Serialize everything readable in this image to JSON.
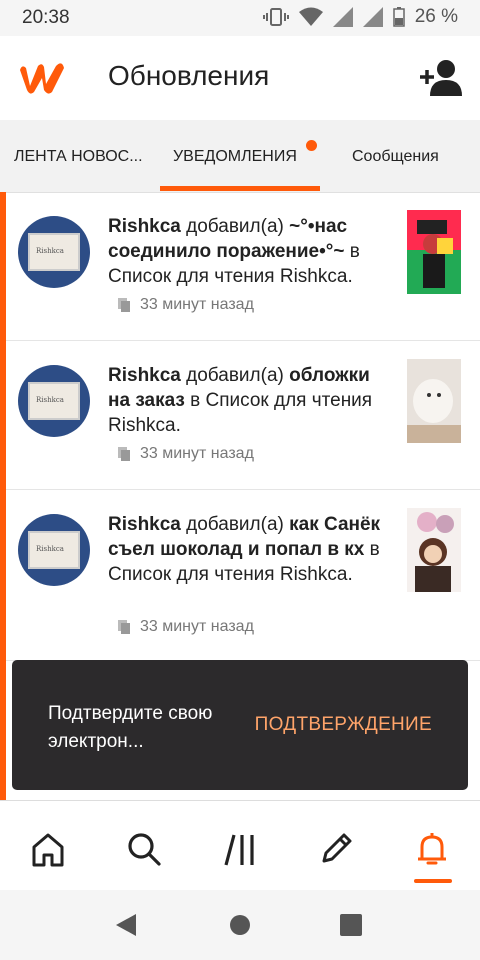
{
  "status": {
    "time": "20:38",
    "battery": "26 %"
  },
  "header": {
    "title": "Обновления"
  },
  "tabs": [
    {
      "label": "ЛЕНТА НОВОС..."
    },
    {
      "label": "УВЕДОМЛЕНИЯ"
    },
    {
      "label": "Сообщения"
    }
  ],
  "notifications": [
    {
      "user": "Rishkca",
      "action": "добавил(а)",
      "story": "~°•нас соединило поражение•°~",
      "prep": "в",
      "list": "Список для чтения Rishkca",
      "time": "33 минут назад"
    },
    {
      "user": "Rishkca",
      "action": "добавил(а)",
      "story": "обложки на заказ",
      "prep": "в",
      "list": "Список для чтения Rishkca",
      "time": "33 минут назад"
    },
    {
      "user": "Rishkca",
      "action": "добавил(а)",
      "story": "как Санёк съел шоколад и попал в кх",
      "prep": "в",
      "list": "Список для чтения Rishkca",
      "time": "33 минут назад"
    }
  ],
  "snackbar": {
    "message": "Подтвердите свою электрон...",
    "action": "ПОДТВЕРЖДЕНИЕ"
  },
  "bottom_nav": [
    "home-icon",
    "search-icon",
    "library-icon",
    "write-icon",
    "notifications-icon"
  ],
  "colors": {
    "accent": "#ff5a0a",
    "snack_action": "#ffa46a"
  }
}
